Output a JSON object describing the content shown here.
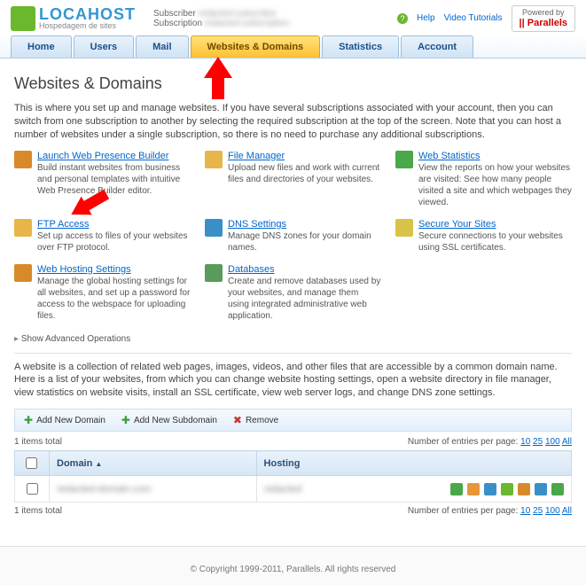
{
  "header": {
    "logo_main": "LOCAHOST",
    "logo_sub": "Hospedagem de sites",
    "subscriber_label": "Subscriber",
    "subscriber_value": "redacted-subscriber",
    "subscription_label": "Subscription",
    "subscription_value": "redacted-subscription",
    "help": "Help",
    "tutorials": "Video Tutorials",
    "powered_label": "Powered by",
    "powered_brand": "|| Parallels"
  },
  "nav": {
    "tabs": [
      "Home",
      "Users",
      "Mail",
      "Websites & Domains",
      "Statistics",
      "Account"
    ],
    "active_index": 3
  },
  "page": {
    "title": "Websites & Domains",
    "intro": "This is where you set up and manage websites. If you have several subscriptions associated with your account, then you can switch from one subscription to another by selecting the required subscription at the top of the screen. Note that you can host a number of websites under a single subscription, so there is no need to purchase any additional subscriptions.",
    "advanced": "Show Advanced Operations",
    "note": "A website is a collection of related web pages, images, videos, and other files that are accessible by a common domain name. Here is a list of your websites, from which you can change website hosting settings, open a website directory in file manager, view statistics on website visits, install an SSL certificate, view web server logs, and change DNS zone settings."
  },
  "tools": [
    {
      "title": "Launch Web Presence Builder",
      "desc": "Build instant websites from business and personal templates with intuitive Web Presence Builder editor.",
      "icon": "#d88a2a"
    },
    {
      "title": "File Manager",
      "desc": "Upload new files and work with current files and directories of your websites.",
      "icon": "#e7b54a"
    },
    {
      "title": "Web Statistics",
      "desc": "View the reports on how your websites are visited: See how many people visited a site and which webpages they viewed.",
      "icon": "#4aa74a"
    },
    {
      "title": "FTP Access",
      "desc": "Set up access to files of your websites over FTP protocol.",
      "icon": "#e7b54a"
    },
    {
      "title": "DNS Settings",
      "desc": "Manage DNS zones for your domain names.",
      "icon": "#3a8fc8"
    },
    {
      "title": "Secure Your Sites",
      "desc": "Secure connections to your websites using SSL certificates.",
      "icon": "#d8c34a"
    },
    {
      "title": "Web Hosting Settings",
      "desc": "Manage the global hosting settings for all websites, and set up a password for access to the webspace for uploading files.",
      "icon": "#d88a2a"
    },
    {
      "title": "Databases",
      "desc": "Create and remove databases used by your websites, and manage them using integrated administrative web application.",
      "icon": "#5a9a5a"
    }
  ],
  "toolbar": {
    "add_domain": "Add New Domain",
    "add_subdomain": "Add New Subdomain",
    "remove": "Remove"
  },
  "pager": {
    "items_total": "1 items total",
    "per_page_label": "Number of entries per page:",
    "options": [
      "10",
      "25",
      "100",
      "All"
    ]
  },
  "table": {
    "col_domain": "Domain",
    "col_hosting": "Hosting",
    "rows": [
      {
        "domain": "redacted-domain.com",
        "hosting": "redacted"
      }
    ],
    "row_icon_colors": [
      "#4aa74a",
      "#e7963a",
      "#3a8fc8",
      "#6ab82e",
      "#d88a2a",
      "#3a8fc8",
      "#4aa74a"
    ]
  },
  "footer": "© Copyright 1999-2011, Parallels. All rights reserved"
}
